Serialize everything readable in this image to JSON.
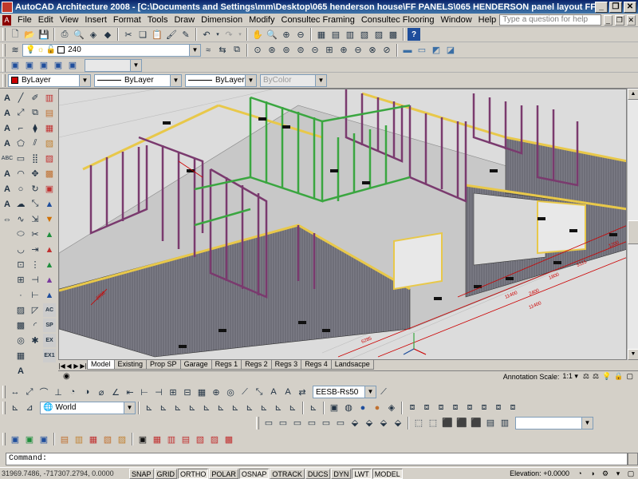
{
  "window": {
    "title": "AutoCAD Architecture 2008 - [C:\\Documents and Settings\\mm\\Desktop\\065 henderson house\\FF PANELS\\065 HENDERSON  panel layout FF REV B.dwg]",
    "min": "_",
    "restore": "❐",
    "close": "✕"
  },
  "menu": {
    "items": [
      "File",
      "Edit",
      "View",
      "Insert",
      "Format",
      "Tools",
      "Draw",
      "Dimension",
      "Modify",
      "Consultec Framing",
      "Consultec Flooring",
      "Window",
      "Help"
    ],
    "help_placeholder": "Type a question for help",
    "doc_min": "_",
    "doc_restore": "❐",
    "doc_close": "✕"
  },
  "layer_toolbar": {
    "layer_value": "240"
  },
  "properties_toolbar": {
    "color": "ByLayer",
    "linetype": "ByLayer",
    "lineweight": "ByLayer",
    "plotstyle": "ByColor",
    "color_swatch": "#cc0000"
  },
  "layout_tabs": [
    "Model",
    "Existing",
    "Prop SP",
    "Garage",
    "Regs 1",
    "Regs 2",
    "Regs 3",
    "Regs 4",
    "Landsacpe"
  ],
  "annotation": {
    "label": "Annotation Scale:",
    "value": "1:1 ▾"
  },
  "toolbar_row3": {
    "dimstyle": "EESB-Rs50"
  },
  "ucs": {
    "value": "World"
  },
  "drawing_dims": {
    "d1": "2950",
    "d2": "6285",
    "d3": "2400",
    "d4": "11400",
    "d5": "1800",
    "d6": "5115",
    "d7": "11400",
    "d8": "1200"
  },
  "command": {
    "text": "Command:"
  },
  "status": {
    "coords": "31969.7486, -717307.2794, 0.0000",
    "buttons": [
      "SNAP",
      "GRID",
      "ORTHO",
      "POLAR",
      "OSNAP",
      "OTRACK",
      "DUCS",
      "DYN",
      "LWT",
      "MODEL"
    ],
    "on": [
      "ORTHO",
      "OSNAP",
      "LWT",
      "MODEL"
    ],
    "elevation_label": "Elevation:",
    "elevation_value": "+0.0000"
  },
  "colors": {
    "title_bar": "#0a246a",
    "framing_purple": "#7a3a6e",
    "framing_green": "#3aa640",
    "framing_yellow": "#e8c84a",
    "floor_grey": "#c8c8c8",
    "dimension_red": "#cc0000"
  }
}
